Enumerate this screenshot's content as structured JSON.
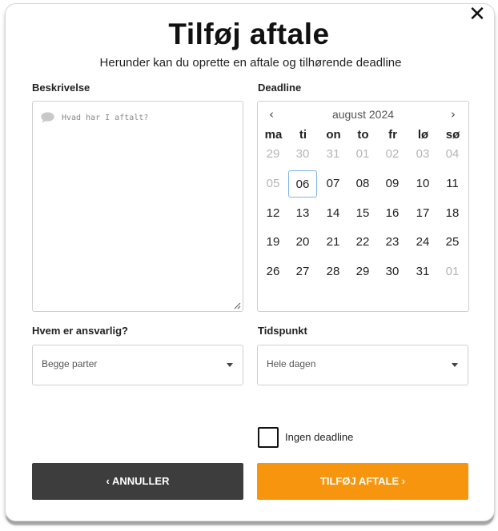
{
  "dialog": {
    "title": "Tilføj aftale",
    "subtitle": "Herunder kan du oprette en aftale og tilhørende deadline"
  },
  "description": {
    "label": "Beskrivelse",
    "placeholder": "Hvad har I aftalt?"
  },
  "deadline": {
    "label": "Deadline",
    "month_label": "august 2024",
    "prev_icon": "‹",
    "next_icon": "›",
    "weekdays": [
      "ma",
      "ti",
      "on",
      "to",
      "fr",
      "lø",
      "sø"
    ],
    "weeks": [
      [
        "29",
        "30",
        "31",
        "01",
        "02",
        "03",
        "04"
      ],
      [
        "05",
        "06",
        "07",
        "08",
        "09",
        "10",
        "11"
      ],
      [
        "12",
        "13",
        "14",
        "15",
        "16",
        "17",
        "18"
      ],
      [
        "19",
        "20",
        "21",
        "22",
        "23",
        "24",
        "25"
      ],
      [
        "26",
        "27",
        "28",
        "29",
        "30",
        "31",
        "01"
      ]
    ],
    "selected": "06"
  },
  "responsible": {
    "label": "Hvem er ansvarlig?",
    "value": "Begge parter"
  },
  "time": {
    "label": "Tidspunkt",
    "value": "Hele dagen"
  },
  "no_deadline": {
    "label": "Ingen deadline",
    "checked": false
  },
  "buttons": {
    "cancel": "‹ ANNULLER",
    "add": "TILFØJ AFTALE ›"
  },
  "colors": {
    "primary": "#f7960e",
    "dark": "#3d3d3d",
    "selected_border": "#7fb1e8"
  }
}
